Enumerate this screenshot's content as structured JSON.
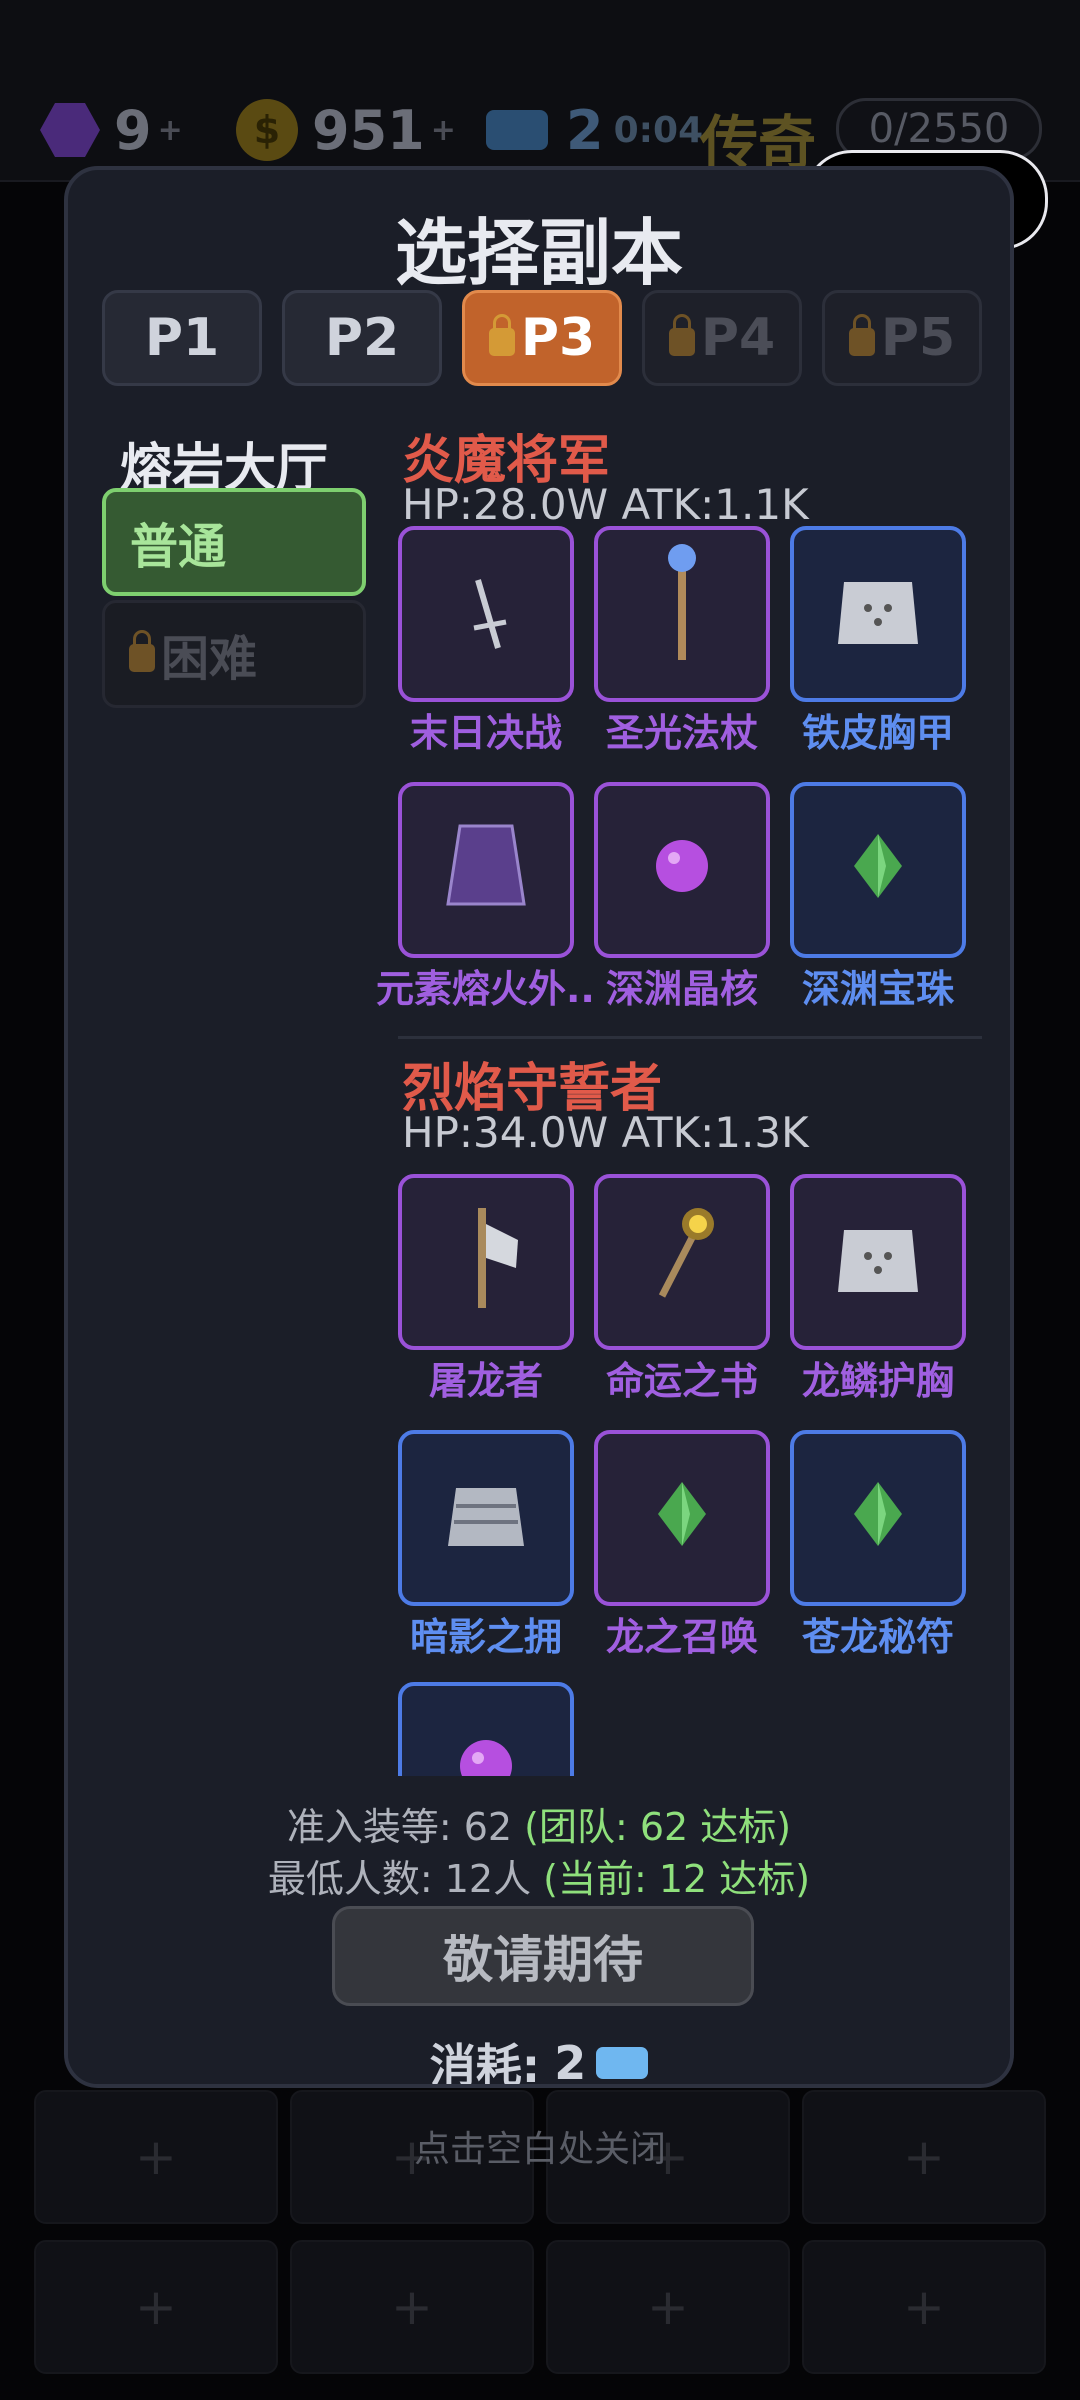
{
  "topbar": {
    "gems": "9",
    "gems_plus": "+",
    "coins": "951",
    "coins_plus": "+",
    "coin_symbol": "$",
    "tickets": "2",
    "timer": "0:04",
    "tier": "传奇",
    "progress": "0/2550"
  },
  "modal": {
    "title": "选择副本",
    "tabs": [
      {
        "label": "P1",
        "state": "unlocked"
      },
      {
        "label": "P2",
        "state": "unlocked"
      },
      {
        "label": "P3",
        "state": "selected"
      },
      {
        "label": "P4",
        "state": "locked"
      },
      {
        "label": "P5",
        "state": "locked"
      }
    ],
    "zone": "熔岩大厅",
    "difficulty": {
      "normal": "普通",
      "hard": "困难"
    },
    "bosses": [
      {
        "name": "炎魔将军",
        "stats": "HP:28.0W   ATK:1.1K",
        "items": [
          {
            "name": "末日决战",
            "rarity": "purple",
            "icon": "sword-icon"
          },
          {
            "name": "圣光法杖",
            "rarity": "purple",
            "icon": "staff-icon"
          },
          {
            "name": "铁皮胸甲",
            "rarity": "blue",
            "icon": "chest-armor-icon"
          },
          {
            "name": "元素熔火外...",
            "rarity": "purple",
            "icon": "cloak-icon"
          },
          {
            "name": "深渊晶核",
            "rarity": "purple",
            "icon": "orb-icon"
          },
          {
            "name": "深渊宝珠",
            "rarity": "blue",
            "icon": "gem-icon"
          }
        ]
      },
      {
        "name": "烈焰守誓者",
        "stats": "HP:34.0W   ATK:1.3K",
        "items": [
          {
            "name": "屠龙者",
            "rarity": "purple",
            "icon": "axe-icon"
          },
          {
            "name": "命运之书",
            "rarity": "purple",
            "icon": "wand-icon"
          },
          {
            "name": "龙鳞护胸",
            "rarity": "purple",
            "icon": "chest-armor-icon"
          },
          {
            "name": "暗影之拥",
            "rarity": "blue",
            "icon": "leg-armor-icon"
          },
          {
            "name": "龙之召唤",
            "rarity": "purple",
            "icon": "gem-icon"
          },
          {
            "name": "苍龙秘符",
            "rarity": "blue",
            "icon": "gem-icon"
          },
          {
            "name": "",
            "rarity": "blue",
            "icon": "orb-icon"
          }
        ]
      }
    ],
    "requirement_level": {
      "text": "准入装等: 62 ",
      "status": "(团队: 62 达标)"
    },
    "requirement_people": {
      "text": "最低人数: 12人 ",
      "status": "(当前: 12 达标)"
    },
    "action_button": "敬请期待",
    "cost_label": "消耗:",
    "cost_value": "2"
  },
  "close_hint": "点击空白处关闭",
  "colors": {
    "accent": "#c1632b",
    "purple": "#9a52d8",
    "blue": "#4d7be6",
    "ok_green": "#8fe07c",
    "boss_red": "#e15a4a"
  }
}
